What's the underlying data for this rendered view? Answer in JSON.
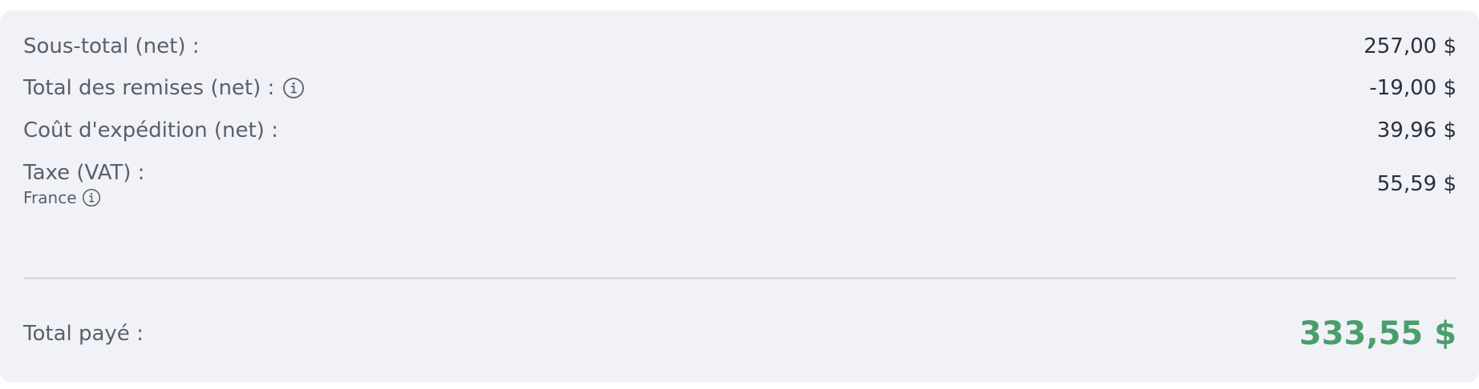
{
  "summary": {
    "rows": [
      {
        "label": "Sous-total (net) :",
        "value": "257,00 $"
      },
      {
        "label": "Total des remises (net) :",
        "value": "-19,00 $"
      },
      {
        "label": "Coût d'expédition (net) :",
        "value": "39,96 $"
      },
      {
        "label": "Taxe (VAT) :",
        "sublabel": "France",
        "value": "55,59 $"
      }
    ],
    "total": {
      "label": "Total payé :",
      "value": "333,55 $"
    },
    "icons": {
      "discount_info": "info-icon",
      "tax_info": "info-icon"
    },
    "colors": {
      "total_value": "#4a9e6b",
      "card_background": "#f1f2f7"
    }
  }
}
